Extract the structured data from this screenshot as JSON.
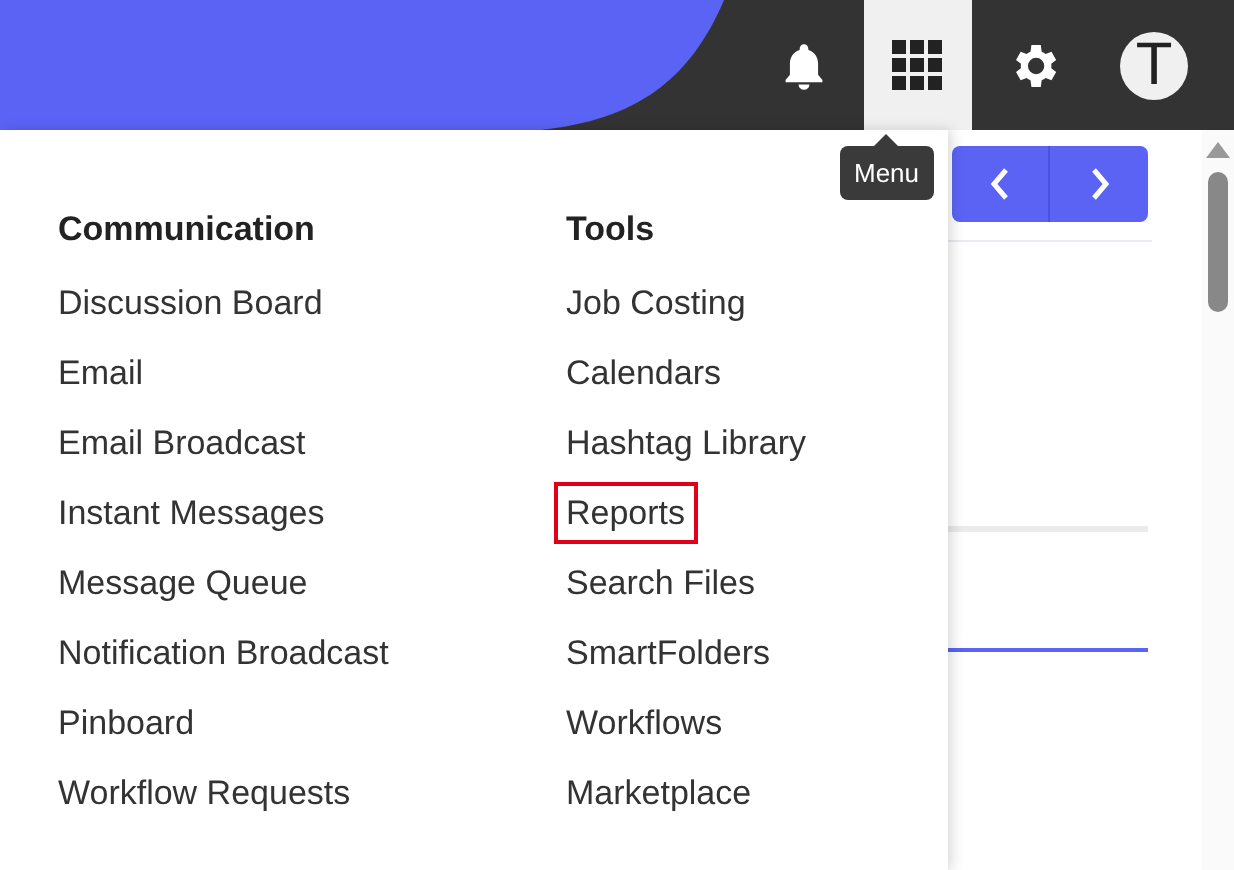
{
  "top_bar": {
    "avatar_letter": "T",
    "tooltip": "Menu",
    "menu_button_selected": true
  },
  "menu": {
    "columns": [
      {
        "heading": "Communication",
        "items": [
          {
            "label": "Discussion Board",
            "highlighted": false
          },
          {
            "label": "Email",
            "highlighted": false
          },
          {
            "label": "Email Broadcast",
            "highlighted": false
          },
          {
            "label": "Instant Messages",
            "highlighted": false
          },
          {
            "label": "Message Queue",
            "highlighted": false
          },
          {
            "label": "Notification Broadcast",
            "highlighted": false
          },
          {
            "label": "Pinboard",
            "highlighted": false
          },
          {
            "label": "Workflow Requests",
            "highlighted": false
          }
        ]
      },
      {
        "heading": "Tools",
        "items": [
          {
            "label": "Job Costing",
            "highlighted": false
          },
          {
            "label": "Calendars",
            "highlighted": false
          },
          {
            "label": "Hashtag Library",
            "highlighted": false
          },
          {
            "label": "Reports",
            "highlighted": true
          },
          {
            "label": "Search Files",
            "highlighted": false
          },
          {
            "label": "SmartFolders",
            "highlighted": false
          },
          {
            "label": "Workflows",
            "highlighted": false
          },
          {
            "label": "Marketplace",
            "highlighted": false
          }
        ]
      }
    ]
  }
}
